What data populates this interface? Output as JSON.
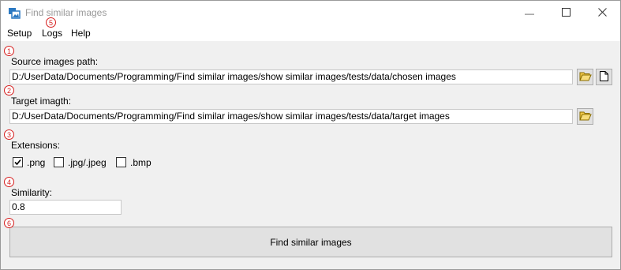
{
  "window": {
    "title": "Find similar images",
    "minimize_glyph": "—",
    "maximize_glyph": "☐",
    "close_glyph": "✕"
  },
  "menu": [
    "Setup",
    "Logs",
    "Help"
  ],
  "source": {
    "label": "Source images path:",
    "value": "D:/UserData/Documents/Programming/Find similar images/show similar images/tests/data/chosen images"
  },
  "target": {
    "label": "Target imagth:",
    "value": "D:/UserData/Documents/Programming/Find similar images/show similar images/tests/data/target images"
  },
  "extensions": {
    "label": "Extensions:",
    "items": [
      {
        "label": ".png",
        "checked": true
      },
      {
        "label": ".jpg/.jpeg",
        "checked": false
      },
      {
        "label": ".bmp",
        "checked": false
      }
    ]
  },
  "similarity": {
    "label": "Similarity:",
    "value": "0.8"
  },
  "action": {
    "label": "Find similar images"
  },
  "annotations": [
    "1",
    "2",
    "3",
    "4",
    "5",
    "6"
  ],
  "icons": {
    "folder": "folder-open-icon",
    "new_file": "new-file-icon",
    "app": "app-icon"
  },
  "colors": {
    "annotation": "#d61f1f",
    "folder": "#f2c94c"
  }
}
